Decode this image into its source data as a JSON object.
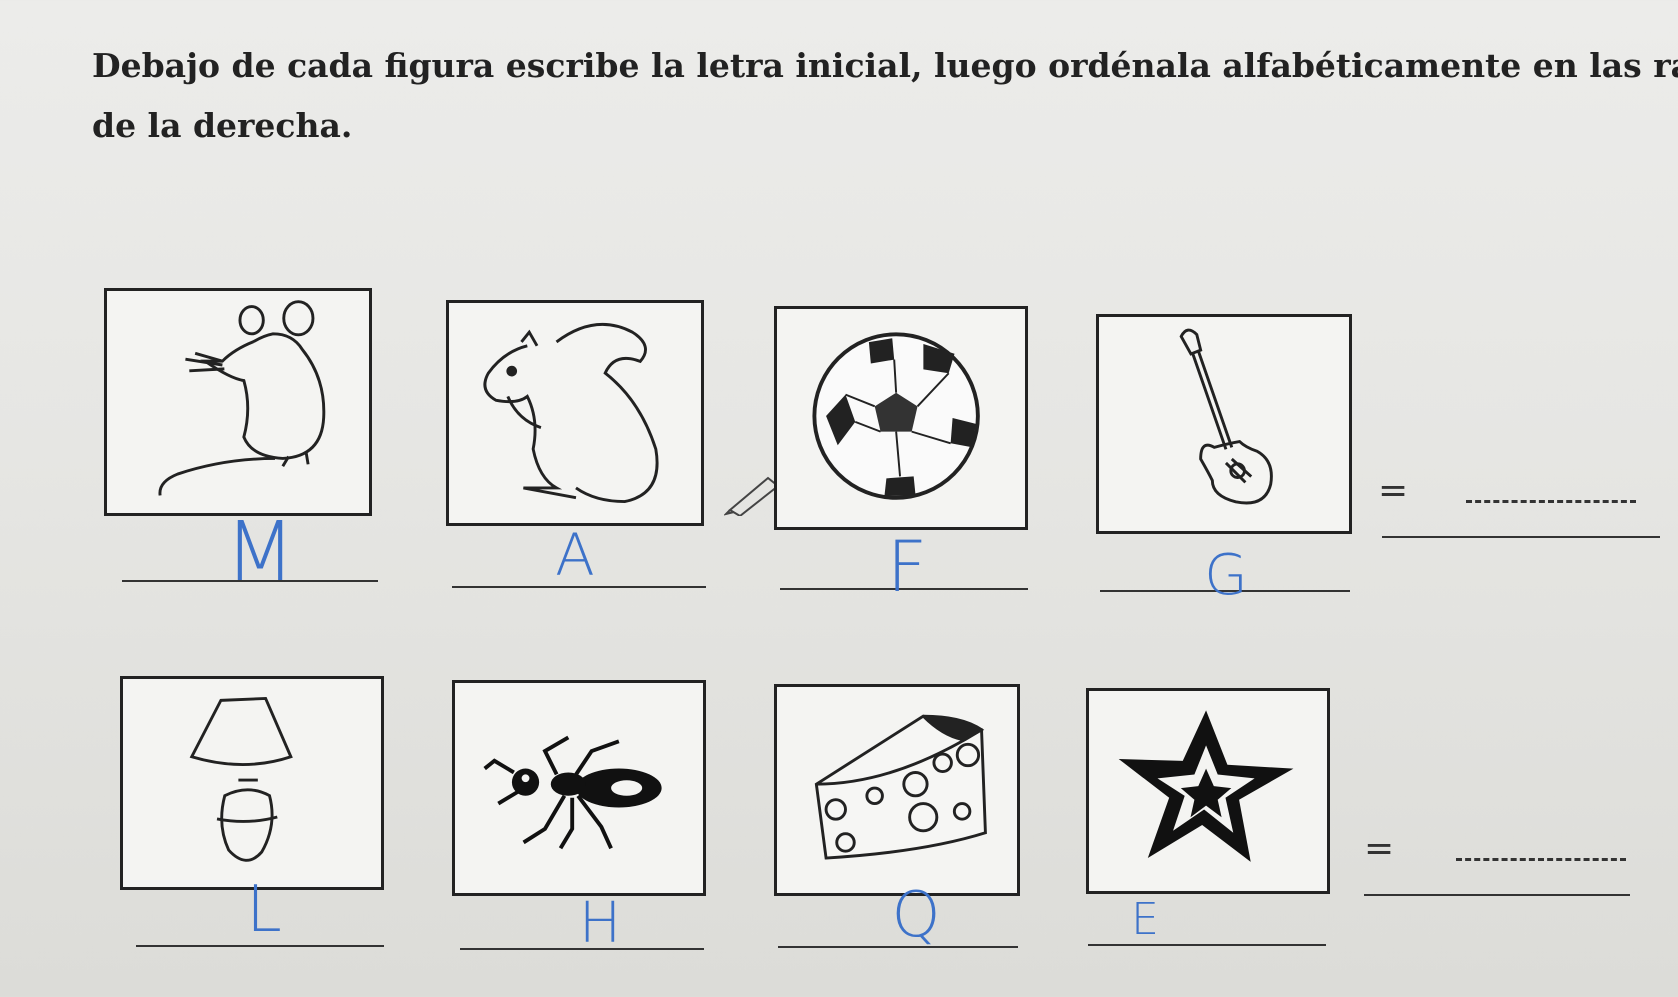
{
  "instructions": {
    "line1": "Debajo de cada figura escribe la letra inicial, luego ordénala alfabéticamente en las rayas",
    "line2": "de la derecha."
  },
  "rows": [
    {
      "items": [
        {
          "picture": "mouse-icon",
          "answer": "M"
        },
        {
          "picture": "squirrel-icon",
          "answer": "A"
        },
        {
          "picture": "soccer-ball-icon",
          "answer": "F"
        },
        {
          "picture": "guitar-icon",
          "answer": "G"
        }
      ],
      "equals": "="
    },
    {
      "items": [
        {
          "picture": "lamp-icon",
          "answer": "L"
        },
        {
          "picture": "ant-icon",
          "answer": "H"
        },
        {
          "picture": "cheese-icon",
          "answer": "Q"
        },
        {
          "picture": "star-icon",
          "answer": "E"
        }
      ],
      "equals": "="
    }
  ],
  "colors": {
    "ink": "#222222",
    "handwriting": "#3d72c9",
    "paper": "#e8e8e5"
  }
}
